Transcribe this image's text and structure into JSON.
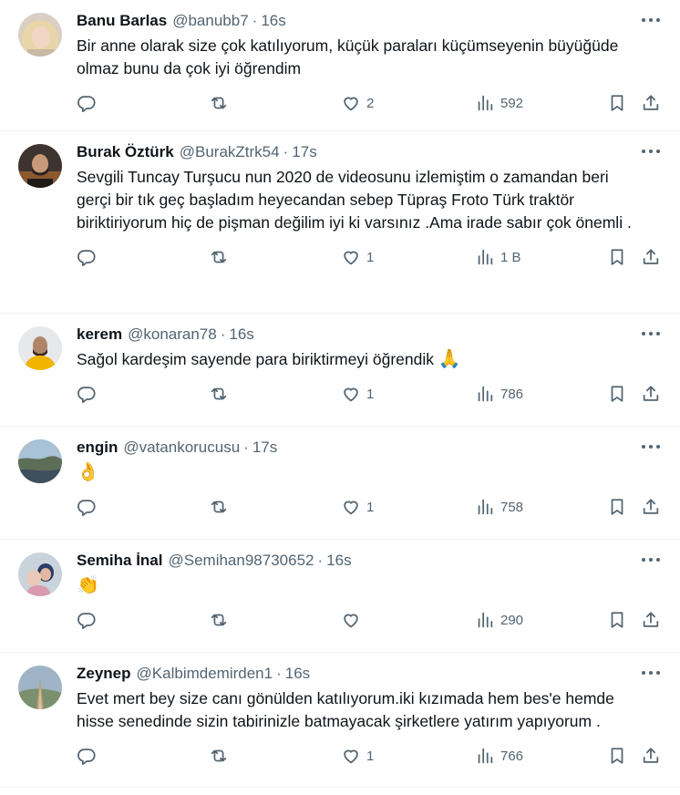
{
  "tweets": [
    {
      "name": "Banu Barlas",
      "handle": "@banubb7",
      "time": "16s",
      "text": "Bir anne olarak size çok katılıyorum, küçük paraları küçümseyenin büyüğüde olmaz bunu da çok iyi öğrendim",
      "emoji": "",
      "likes": "2",
      "views": "592",
      "avatar": "blonde-woman"
    },
    {
      "name": "Burak Öztürk",
      "handle": "@BurakZtrk54",
      "time": "17s",
      "text": "Sevgili Tuncay Turşucu nun 2020 de videosunu izlemiştim  o zamandan beri gerçi bir tık geç başladım heyecandan sebep Tüpraş Froto Türk traktör biriktiriyorum hiç de pişman değilim iyi ki varsınız .Ama irade sabır çok önemli .",
      "emoji": "",
      "likes": "1",
      "views": "1 B",
      "avatar": "bearded-man"
    },
    {
      "name": "kerem",
      "handle": "@konaran78",
      "time": "16s",
      "text": "Sağol kardeşim sayende para biriktirmeyi öğrendik",
      "emoji": "🙏",
      "likes": "1",
      "views": "786",
      "avatar": "man-yellow-jacket"
    },
    {
      "name": "engin",
      "handle": "@vatankorucusu",
      "time": "17s",
      "text": "",
      "emoji": "👌",
      "likes": "1",
      "views": "758",
      "avatar": "aerial-landscape"
    },
    {
      "name": "Semiha İnal",
      "handle": "@Semihan98730652",
      "time": "16s",
      "text": "",
      "emoji": "👏",
      "likes": "",
      "views": "290",
      "avatar": "woman-and-child"
    },
    {
      "name": "Zeynep",
      "handle": "@Kalbimdemirden1",
      "time": "16s",
      "text": "Evet mert bey size canı gönülden katılıyorum.iki kızımada hem bes'e hemde hisse senedinde sizin tabirinizle batmayacak şirketlere yatırım yapıyorum .",
      "emoji": "",
      "likes": "1",
      "views": "766",
      "avatar": "boardwalk"
    }
  ],
  "colors": {
    "text": "#0f1419",
    "muted": "#536471",
    "divider": "#eff3f4"
  }
}
